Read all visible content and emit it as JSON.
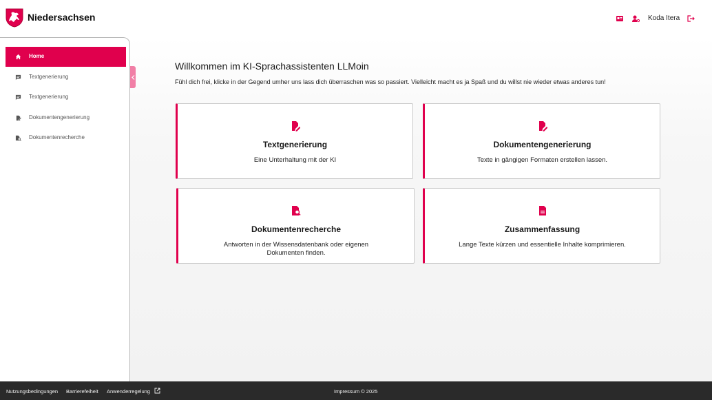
{
  "header": {
    "brand": "Niedersachsen",
    "username": "Koda Itera",
    "icons": [
      "id-card-icon",
      "user-settings-icon",
      "logout-icon"
    ]
  },
  "sidebar": {
    "items": [
      {
        "label": "Home",
        "icon": "home-icon",
        "active": true
      },
      {
        "label": "Textgenerierung",
        "icon": "chat-icon",
        "active": false
      },
      {
        "label": "Textgenerierung",
        "icon": "chat-icon",
        "active": false
      },
      {
        "label": "Dokumentengenerierung",
        "icon": "document-edit-icon",
        "active": false
      },
      {
        "label": "Dokumentenrecherche",
        "icon": "document-search-icon",
        "active": false
      }
    ]
  },
  "main": {
    "title": "Willkommen im KI-Sprachassistenten LLMoin",
    "subtitle": "Fühl dich frei, klicke in der Gegend umher uns lass dich überraschen was so passiert. Vielleicht macht es ja Spaß und du willst nie wieder etwas anderes tun!",
    "cards": [
      {
        "title": "Textgenerierung",
        "description": "Eine Unterhaltung mit der KI",
        "icon": "edit-document-icon"
      },
      {
        "title": "Dokumentengenerierung",
        "description": "Texte in gängigen Formaten erstellen lassen.",
        "icon": "edit-document-icon"
      },
      {
        "title": "Dokumentenrecherche",
        "description": "Antworten in der Wissensdatenbank oder eigenen Dokumenten finden.",
        "icon": "document-search-icon"
      },
      {
        "title": "Zusammenfassung",
        "description": "Lange Texte kürzen und essentielle Inhalte komprimieren.",
        "icon": "document-text-icon"
      }
    ]
  },
  "footer": {
    "links": [
      "Nutzungsbedingungen",
      "Barrierefeiheit",
      "Anwenderregelung"
    ],
    "copyright": "Impressum © 2025"
  },
  "colors": {
    "accent": "#e0004d",
    "footer_bg": "#2a2a2a"
  }
}
